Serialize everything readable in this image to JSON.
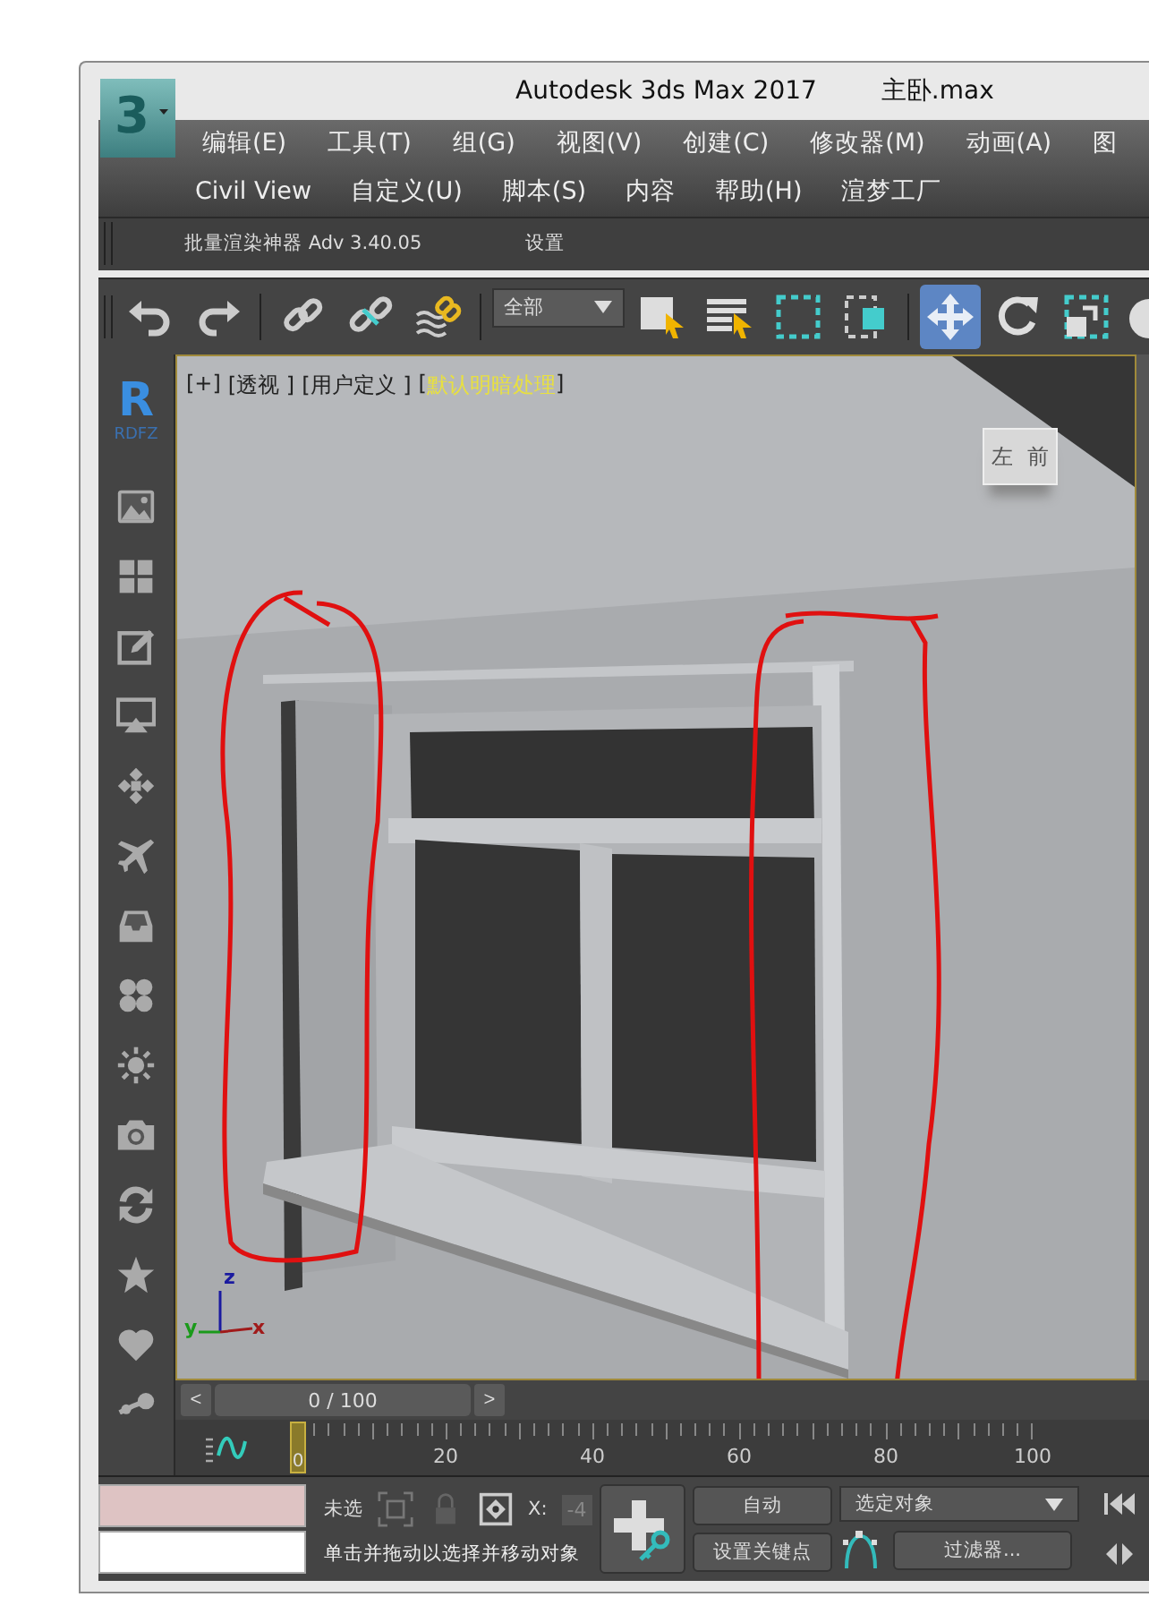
{
  "window": {
    "logo": "3",
    "title": "Autodesk 3ds Max 2017",
    "file": "主卧.max"
  },
  "menu_rows": [
    [
      "编辑(E)",
      "工具(T)",
      "组(G)",
      "视图(V)",
      "创建(C)",
      "修改器(M)",
      "动画(A)",
      "图"
    ],
    [
      "Civil View",
      "自定义(U)",
      "脚本(S)",
      "内容",
      "帮助(H)",
      "渲梦工厂"
    ]
  ],
  "plugin_bar": [
    "批量渲染神器 Adv 3.40.05",
    "设置"
  ],
  "toolbar": {
    "selection_filter": "全部",
    "tools": [
      {
        "selected": false
      },
      {
        "selected": false
      },
      {
        "selected": false
      },
      {
        "selected": false
      },
      {
        "selected": false
      },
      {
        "selected": false
      },
      {
        "selected": false
      },
      {
        "selected": false
      },
      {
        "selected": false
      },
      {
        "selected": true
      },
      {
        "selected": false
      },
      {
        "selected": false
      },
      {
        "selected": false
      }
    ]
  },
  "sidebar": {
    "logo": "R",
    "logo_label": "RDFZ"
  },
  "viewport": {
    "labels": [
      {
        "text": "[+]",
        "highlighted": false
      },
      {
        "text": "[透视 ]",
        "highlighted": false
      },
      {
        "text": "[用户定义 ]",
        "highlighted": false
      },
      {
        "text": "[",
        "highlighted": false
      },
      {
        "text": "默认明暗处理",
        "highlighted": true
      },
      {
        "text": "]",
        "highlighted": false
      }
    ],
    "view_cube": [
      "左",
      "前"
    ],
    "axes": [
      "z",
      "y",
      "x"
    ]
  },
  "time_slider": {
    "prev": "<",
    "reading": "0 / 100",
    "next": ">"
  },
  "track_bar": {
    "current": "0",
    "ticks": [
      "20",
      "40",
      "60",
      "80",
      "100"
    ]
  },
  "status": {
    "selection": "未选",
    "coord_label": "X:",
    "coord_value": "-4",
    "prompt": "单击并拖动以选择并移动对象",
    "auto_key": "自动",
    "set_key": "设置关键点",
    "key_filter": "选定对象",
    "filters": "过滤器..."
  }
}
